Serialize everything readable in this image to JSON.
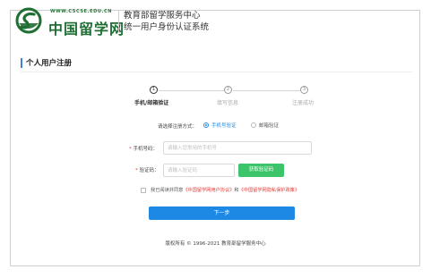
{
  "header": {
    "site_url": "WWW.CSCSE.EDU.CN",
    "brand_name": "中国留学网",
    "org_title": "教育部留学服务中心",
    "system_title": "统一用户身份认证系统",
    "logo_icon": "cscse-logo-icon",
    "brand_color": "#1f6e33"
  },
  "section": {
    "title": "个人用户注册"
  },
  "steps": [
    {
      "number": "1",
      "label": "手机/邮箱验证",
      "active": true
    },
    {
      "number": "2",
      "label": "填写信息",
      "active": false
    },
    {
      "number": "3",
      "label": "注册成功",
      "active": false
    }
  ],
  "form": {
    "method_label": "请选择注册方式：",
    "method_options": [
      {
        "label": "手机号验证",
        "checked": true
      },
      {
        "label": "邮箱验证",
        "checked": false
      }
    ],
    "phone_label": "手机号码：",
    "phone_placeholder": "请输入您常用的手机号",
    "code_label": "验证码：",
    "code_placeholder": "请输入验证码",
    "get_code_button": "获取验证码",
    "agree_prefix": "我已阅读并同意",
    "agree_link1": "《中国留学网用户协议》",
    "agree_mid": "和",
    "agree_link2": "《中国留学网隐私保护政策》",
    "next_button": "下一步",
    "accent_color": "#1e88e5",
    "code_button_color": "#3cc46a"
  },
  "footer": {
    "copyright": "版权所有 © 1996-2021 教育部留学服务中心"
  }
}
